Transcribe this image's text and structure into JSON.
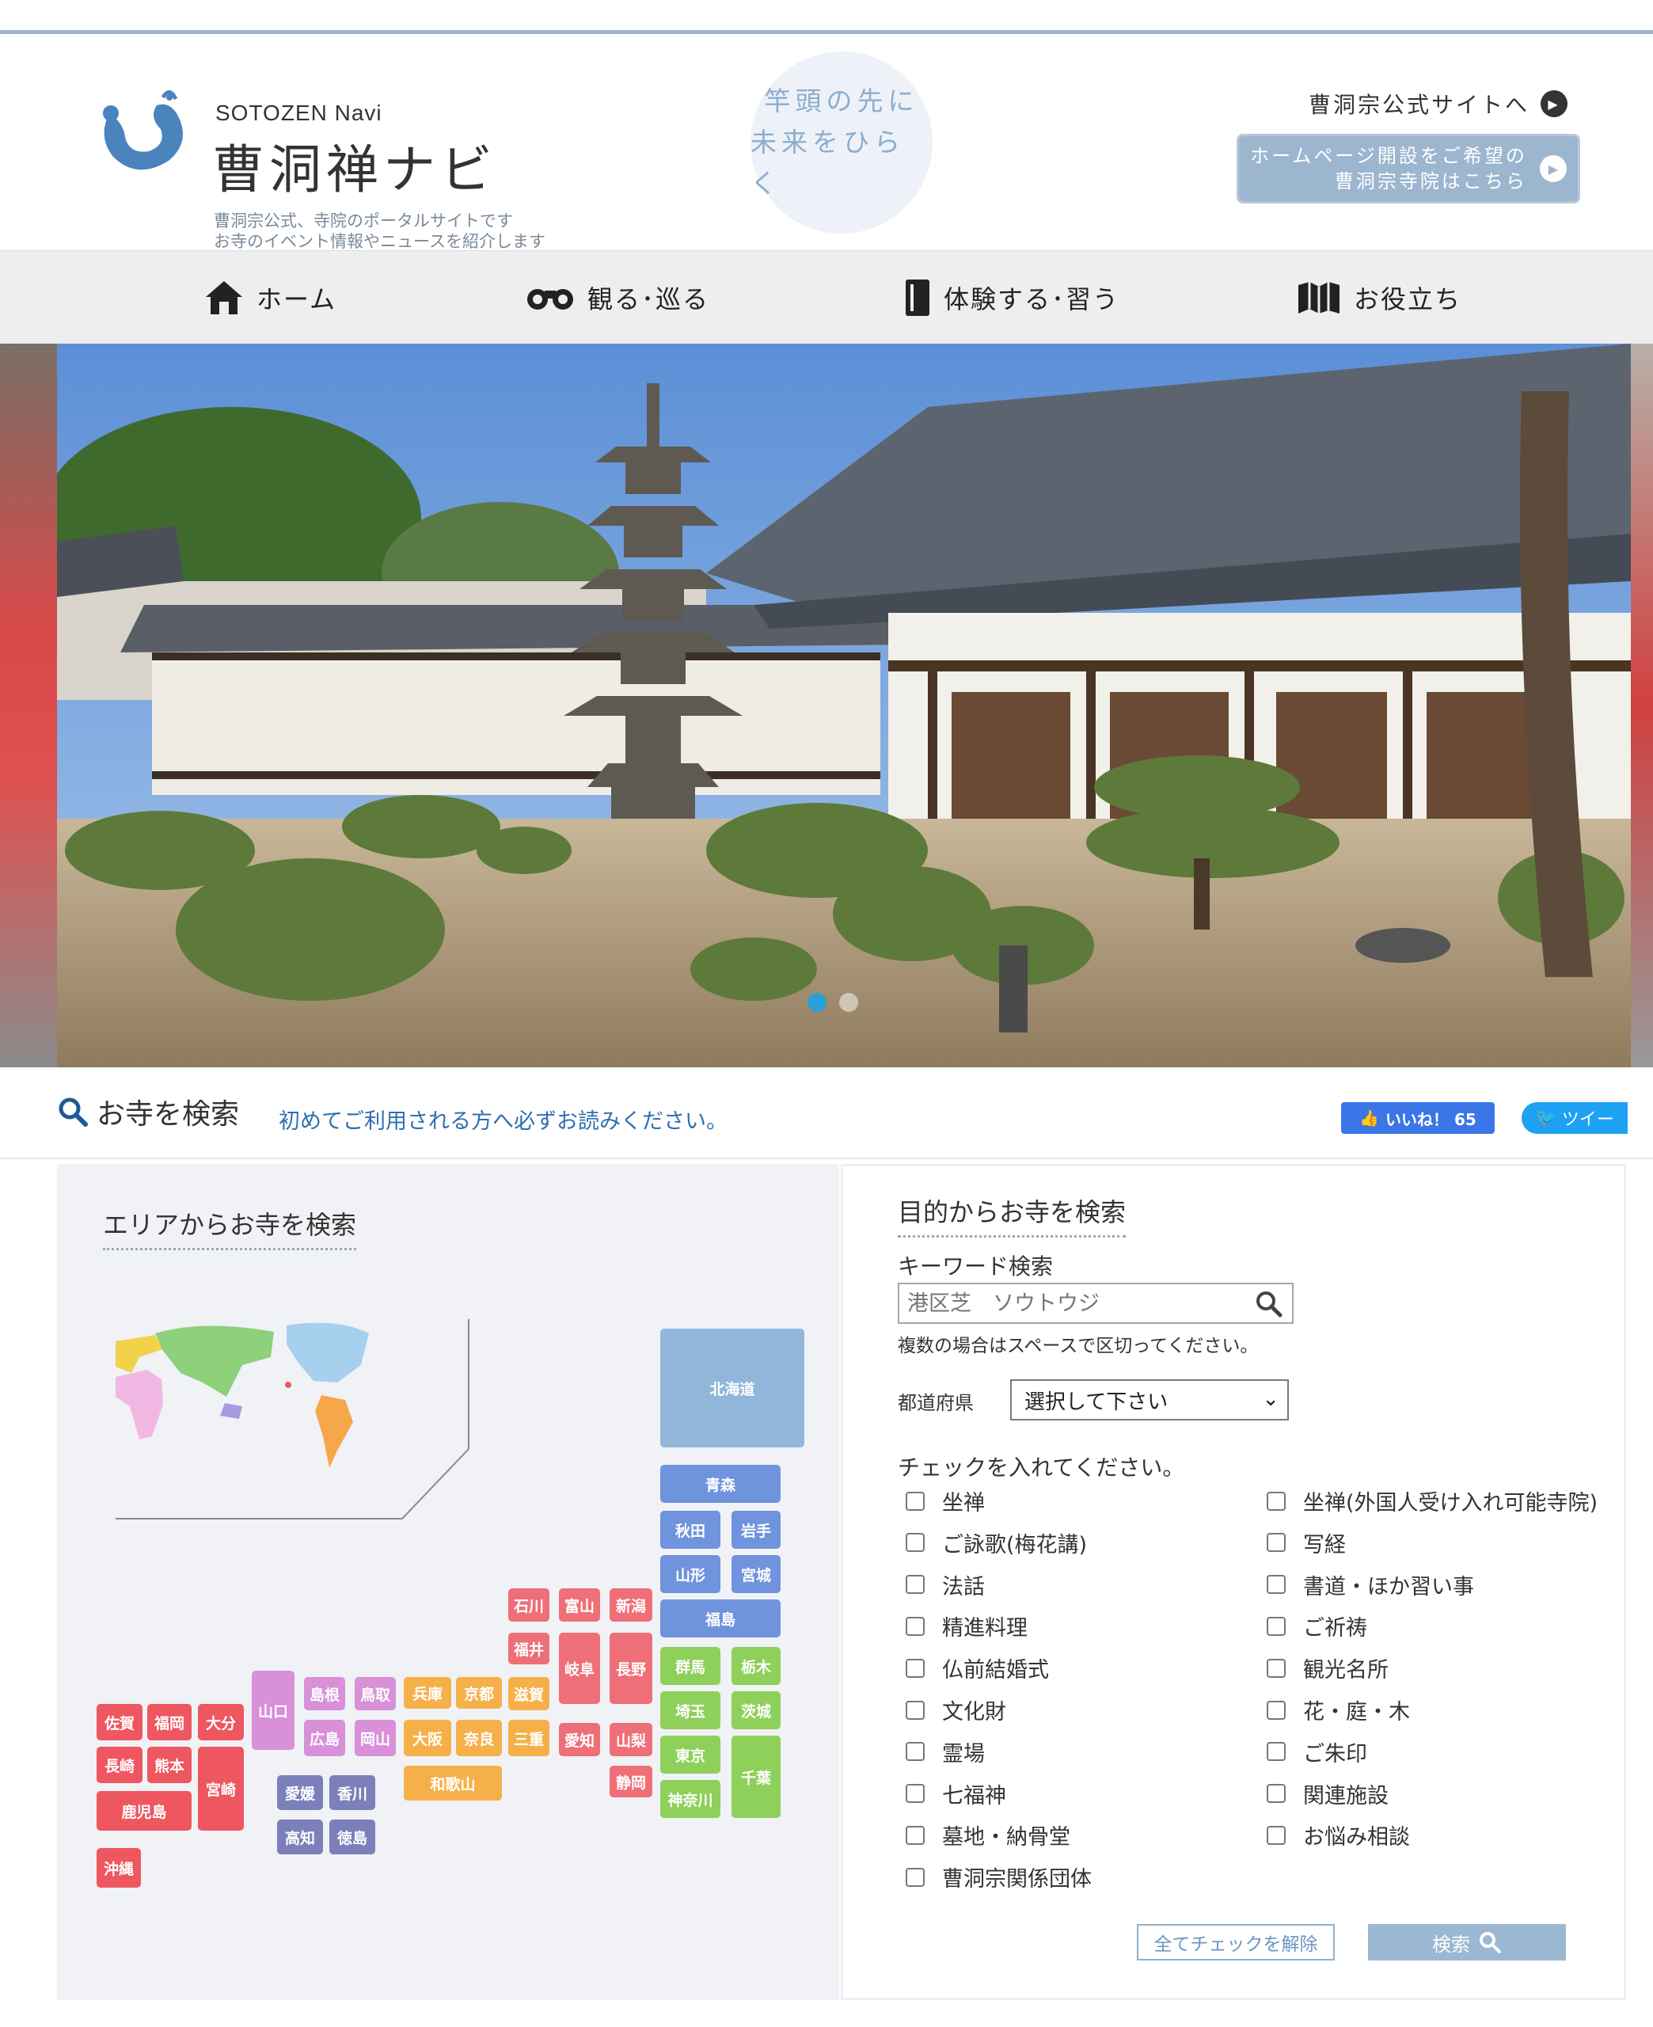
{
  "header": {
    "logo_en": "SOTOZEN Navi",
    "logo_jp": "曹洞禅ナビ",
    "tagline_1": "曹洞宗公式、寺院のポータルサイトです",
    "tagline_2": "お寺のイベント情報やニュースを紹介します",
    "motto_1": "竿頭の先に",
    "motto_2": "未来をひらく",
    "official_link": "曹洞宗公式サイトへ",
    "hp_btn_line1": "ホームページ開設をご希望の",
    "hp_btn_line2": "曹洞宗寺院はこちら"
  },
  "nav": {
    "items": [
      {
        "label": "ホーム",
        "icon": "house-icon"
      },
      {
        "label": "観る･巡る",
        "icon": "binoculars-icon"
      },
      {
        "label": "体験する･習う",
        "icon": "book-icon"
      },
      {
        "label": "お役立ち",
        "icon": "map-icon"
      }
    ]
  },
  "hero": {
    "slides": 2,
    "active_slide": 1
  },
  "search": {
    "title": "お寺を検索",
    "first_link": "初めてご利用される方へ必ずお読みください。",
    "like_label": "いいね！ 65",
    "tweet_label": "ツイー"
  },
  "area": {
    "title": "エリアからお寺を検索",
    "prefectures": {
      "hokkaido": "北海道",
      "aomori": "青森",
      "akita": "秋田",
      "iwate": "岩手",
      "yamagata": "山形",
      "miyagi": "宮城",
      "fukushima": "福島",
      "gunma": "群馬",
      "tochigi": "栃木",
      "saitama": "埼玉",
      "ibaraki": "茨城",
      "tokyo": "東京",
      "chiba": "千葉",
      "kanagawa": "神奈川",
      "ishikawa": "石川",
      "toyama": "富山",
      "niigata": "新潟",
      "fukui": "福井",
      "gifu": "岐阜",
      "nagano": "長野",
      "aichi": "愛知",
      "yamanashi": "山梨",
      "shizuoka": "静岡",
      "hyogo": "兵庫",
      "kyoto": "京都",
      "shiga": "滋賀",
      "osaka": "大阪",
      "nara": "奈良",
      "mie": "三重",
      "wakayama": "和歌山",
      "yamaguchi": "山口",
      "shimane": "島根",
      "tottori": "鳥取",
      "hiroshima": "広島",
      "okayama": "岡山",
      "ehime": "愛媛",
      "kagawa": "香川",
      "kochi": "高知",
      "tokushima": "徳島",
      "saga": "佐賀",
      "fukuoka": "福岡",
      "oita": "大分",
      "nagasaki": "長崎",
      "kumamoto": "熊本",
      "miyazaki": "宮崎",
      "kagoshima": "鹿児島",
      "okinawa": "沖縄"
    }
  },
  "purpose": {
    "title": "目的からお寺を検索",
    "keyword_label": "キーワード検索",
    "keyword_placeholder": "港区芝　ソウトウジ",
    "keyword_note": "複数の場合はスペースで区切ってください。",
    "pref_label": "都道府県",
    "pref_selected": "選択して下さい",
    "check_label": "チェックを入れてください。",
    "checks_left": [
      "坐禅",
      "ご詠歌(梅花講)",
      "法話",
      "精進料理",
      "仏前結婚式",
      "文化財",
      "霊場",
      "七福神",
      "墓地・納骨堂",
      "曹洞宗関係団体"
    ],
    "checks_right": [
      "坐禅(外国人受け入れ可能寺院)",
      "写経",
      "書道・ほか習い事",
      "ご祈祷",
      "観光名所",
      "花・庭・木",
      "ご朱印",
      "関連施設",
      "お悩み相談"
    ],
    "clear_btn": "全てチェックを解除",
    "search_btn": "検索"
  },
  "colors": {
    "hokkaido": "#90b7d9",
    "tohoku": "#6f93dd",
    "kanto": "#8ed05a",
    "chubu": "#ee6f78",
    "kinki": "#f6b04a",
    "chugoku": "#d890d8",
    "shikoku": "#7c7fb9",
    "kyushu": "#ee5660"
  }
}
